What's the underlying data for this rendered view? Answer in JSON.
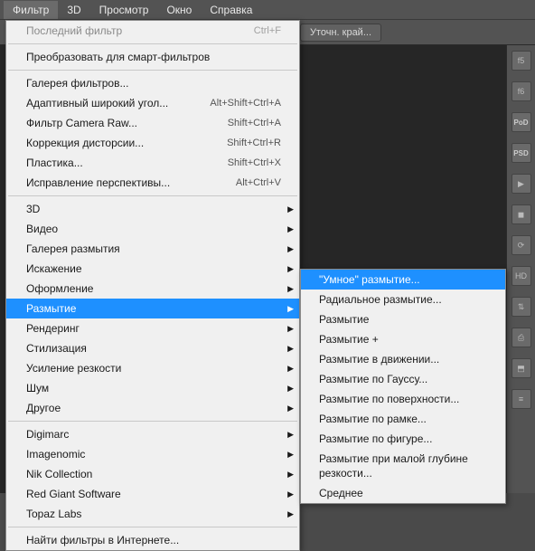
{
  "menubar": [
    "Фильтр",
    "3D",
    "Просмотр",
    "Окно",
    "Справка"
  ],
  "toolbar": {
    "refine": "Уточн. край..."
  },
  "rightIcons": [
    "f5",
    "f6",
    "PoD",
    "PSD",
    "▶",
    "◼",
    "⟳",
    "HD",
    "⇅",
    "⎙",
    "⬒",
    "≡"
  ],
  "menu": [
    {
      "type": "item",
      "label": "Последний фильтр",
      "shortcut": "Ctrl+F",
      "disabled": true
    },
    {
      "type": "sep"
    },
    {
      "type": "item",
      "label": "Преобразовать для смарт-фильтров"
    },
    {
      "type": "sep"
    },
    {
      "type": "item",
      "label": "Галерея фильтров..."
    },
    {
      "type": "item",
      "label": "Адаптивный широкий угол...",
      "shortcut": "Alt+Shift+Ctrl+A"
    },
    {
      "type": "item",
      "label": "Фильтр Camera Raw...",
      "shortcut": "Shift+Ctrl+A"
    },
    {
      "type": "item",
      "label": "Коррекция дисторсии...",
      "shortcut": "Shift+Ctrl+R"
    },
    {
      "type": "item",
      "label": "Пластика...",
      "shortcut": "Shift+Ctrl+X"
    },
    {
      "type": "item",
      "label": "Исправление перспективы...",
      "shortcut": "Alt+Ctrl+V"
    },
    {
      "type": "sep"
    },
    {
      "type": "item",
      "label": "3D",
      "submenu": true
    },
    {
      "type": "item",
      "label": "Видео",
      "submenu": true
    },
    {
      "type": "item",
      "label": "Галерея размытия",
      "submenu": true
    },
    {
      "type": "item",
      "label": "Искажение",
      "submenu": true
    },
    {
      "type": "item",
      "label": "Оформление",
      "submenu": true
    },
    {
      "type": "item",
      "label": "Размытие",
      "submenu": true,
      "highlight": true
    },
    {
      "type": "item",
      "label": "Рендеринг",
      "submenu": true
    },
    {
      "type": "item",
      "label": "Стилизация",
      "submenu": true
    },
    {
      "type": "item",
      "label": "Усиление резкости",
      "submenu": true
    },
    {
      "type": "item",
      "label": "Шум",
      "submenu": true
    },
    {
      "type": "item",
      "label": "Другое",
      "submenu": true
    },
    {
      "type": "sep"
    },
    {
      "type": "item",
      "label": "Digimarc",
      "submenu": true
    },
    {
      "type": "item",
      "label": "Imagenomic",
      "submenu": true
    },
    {
      "type": "item",
      "label": "Nik Collection",
      "submenu": true
    },
    {
      "type": "item",
      "label": "Red Giant Software",
      "submenu": true
    },
    {
      "type": "item",
      "label": "Topaz Labs",
      "submenu": true
    },
    {
      "type": "sep"
    },
    {
      "type": "item",
      "label": "Найти фильтры в Интернете..."
    }
  ],
  "submenu": [
    {
      "label": "\"Умное\" размытие...",
      "highlight": true
    },
    {
      "label": "Радиальное размытие..."
    },
    {
      "label": "Размытие"
    },
    {
      "label": "Размытие +"
    },
    {
      "label": "Размытие в движении..."
    },
    {
      "label": "Размытие по Гауссу..."
    },
    {
      "label": "Размытие по поверхности..."
    },
    {
      "label": "Размытие по рамке..."
    },
    {
      "label": "Размытие по фигуре..."
    },
    {
      "label": "Размытие при малой глубине резкости..."
    },
    {
      "label": "Среднее"
    }
  ]
}
